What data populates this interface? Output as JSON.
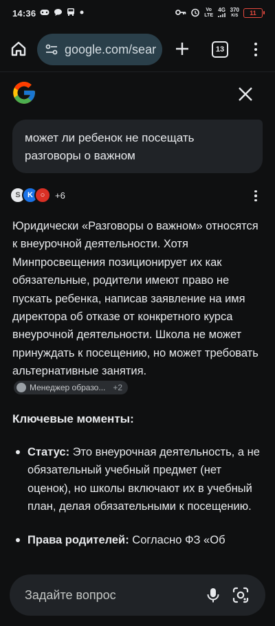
{
  "status_bar": {
    "time": "14:36",
    "net_top": "Vo LTE",
    "net_gen": "4G",
    "speed_value": "370",
    "speed_unit": "K/S",
    "battery": "11"
  },
  "browser": {
    "url": "google.com/sear",
    "tab_count": "13"
  },
  "query": "может ли ребенок не посещать разговоры о важном",
  "sources": {
    "more": "+6",
    "icon1": "S",
    "icon2": "K",
    "icon3": "○"
  },
  "answer": {
    "text": "Юридически «Разговоры о важном» относятся к внеурочной деятельности. Хотя Минпросвещения позиционирует их как обязательные, родители имеют право не пускать ребенка, написав заявление на имя директора об отказе от конкретного курса внеурочной деятельности. Школа не может принуждать к посещению, но может требовать альтернативные занятия.",
    "citation_label": "Менеджер образо...",
    "citation_count": "+2"
  },
  "key_points": {
    "title": "Ключевые моменты:",
    "items": [
      {
        "label": "Статус:",
        "text": " Это внеурочная деятельность, а не обязательный учебный предмет (нет оценок), но школы включают их в учебный план, делая обязательными к посещению."
      },
      {
        "label": "Права родителей:",
        "text": " Согласно ФЗ «Об"
      }
    ]
  },
  "ask_bar": {
    "placeholder": "Задайте вопрос"
  }
}
